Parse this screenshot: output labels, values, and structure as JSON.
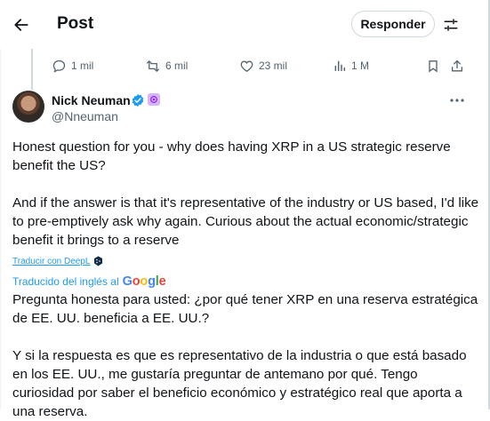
{
  "header": {
    "title": "Post",
    "reply_label": "Responder"
  },
  "actions": {
    "replies": "1 mil",
    "reposts": "6 mil",
    "likes": "23 mil",
    "views": "1 M"
  },
  "author": {
    "name": "Nick Neuman",
    "handle": "@Nneuman",
    "verified_color": "#1d9bf0"
  },
  "tweet": {
    "text": "Honest question for you - why does having XRP in a US strategic reserve benefit the US?\n\nAnd if the answer is that it's representative of the industry or US based, I'd like to pre-emptively ask why again. Curious about the actual economic/strategic benefit it brings to a reserve"
  },
  "translation": {
    "deepl_link": "Traducir con DeepL",
    "translated_by": "Traducido del inglés al",
    "google": [
      "G",
      "o",
      "o",
      "g",
      "l",
      "e"
    ],
    "text": "Pregunta honesta para usted: ¿por qué tener XRP en una reserva estratégica de EE. UU. beneficia a EE. UU.?\n\nY si la respuesta es que es representativo de la industria o que está basado en los EE. UU., me gustaría preguntar de antemano por qué. Tengo curiosidad por saber el beneficio económico y estratégico real que aporta a una reserva."
  },
  "colors": {
    "accent": "#1d9bf0",
    "muted": "#536471",
    "border": "#cfd9de"
  }
}
